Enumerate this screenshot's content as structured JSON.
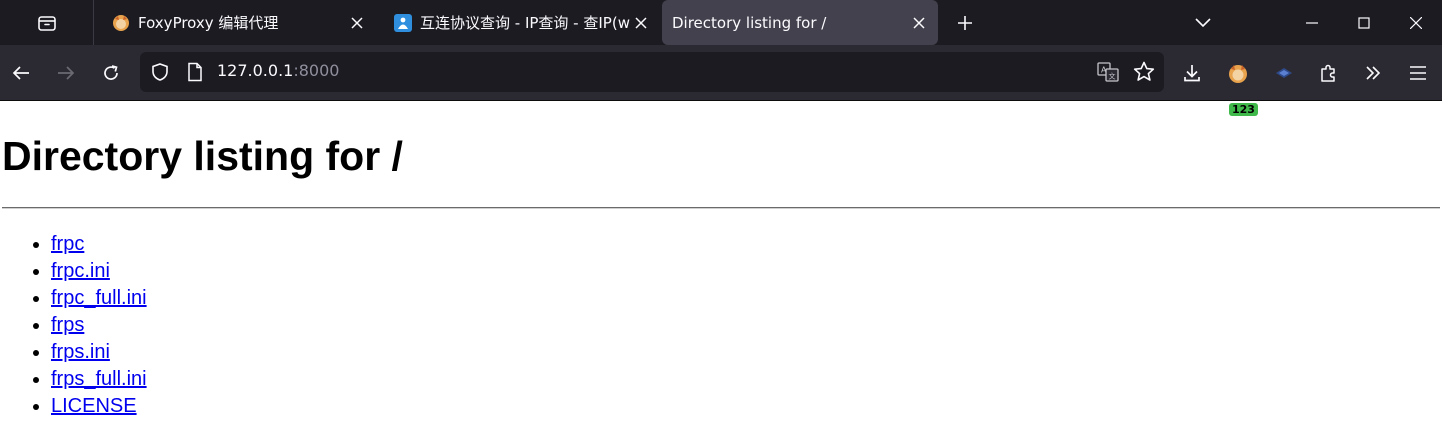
{
  "browser": {
    "tabs": [
      {
        "title": "FoxyProxy 编辑代理",
        "active": false
      },
      {
        "title": "互连协议查询 - IP查询 - 查IP(w",
        "active": false
      },
      {
        "title": "Directory listing for /",
        "active": true
      }
    ],
    "url": {
      "host": "127.0.0.1",
      "port": ":8000"
    },
    "extension_badge": "123"
  },
  "page": {
    "heading": "Directory listing for /",
    "files": [
      {
        "label": "frpc"
      },
      {
        "label": "frpc.ini"
      },
      {
        "label": "frpc_full.ini"
      },
      {
        "label": "frps"
      },
      {
        "label": "frps.ini"
      },
      {
        "label": "frps_full.ini"
      },
      {
        "label": "LICENSE"
      }
    ]
  },
  "colors": {
    "tabbar_bg": "#1c1b22",
    "active_tab_bg": "#42414d",
    "navbar_bg": "#2b2a33",
    "link": "#0000ee",
    "badge": "#3fb94a"
  }
}
